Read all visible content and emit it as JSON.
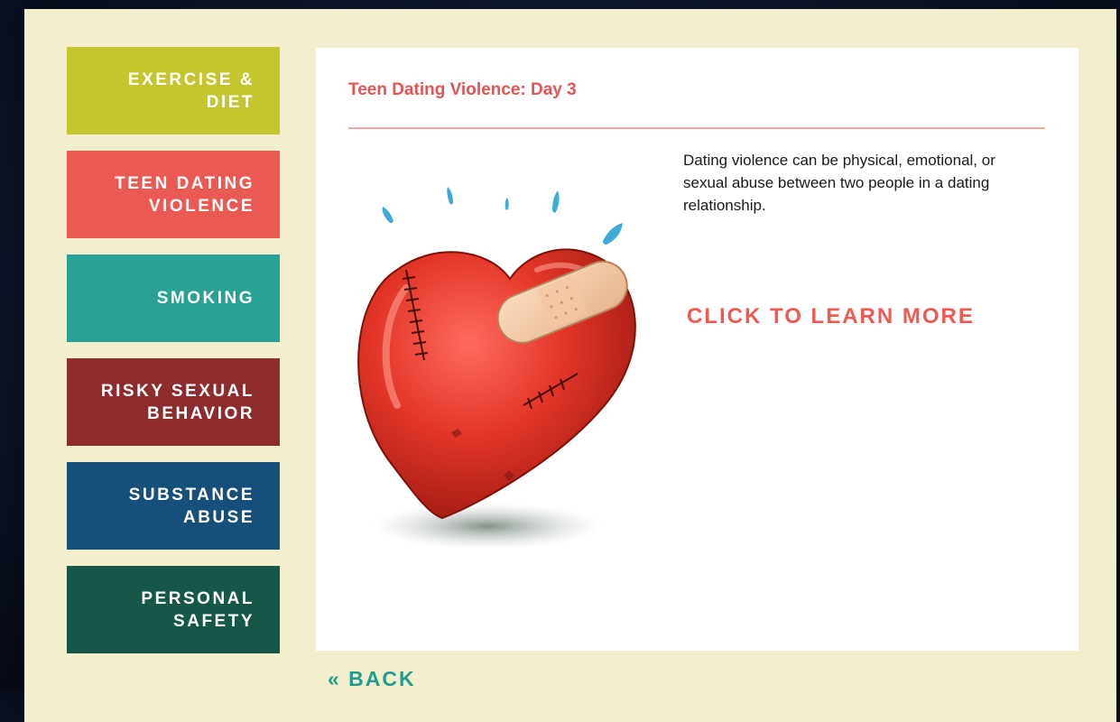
{
  "nav": {
    "items": [
      {
        "label": "EXERCISE &\nDIET",
        "color": "#c5c52f"
      },
      {
        "label": "TEEN DATING\nVIOLENCE",
        "color": "#ea5a53"
      },
      {
        "label": "SMOKING",
        "color": "#27a295"
      },
      {
        "label": "RISKY SEXUAL\nBEHAVIOR",
        "color": "#8e2b2d"
      },
      {
        "label": "SUBSTANCE\nABUSE",
        "color": "#164f7a"
      },
      {
        "label": "PERSONAL\nSAFETY",
        "color": "#17574a"
      }
    ]
  },
  "main": {
    "title": "Teen Dating Violence: Day 3",
    "description": "Dating violence can be physical, emotional, or sexual abuse between two people in a dating relationship.",
    "cta_label": "CLICK TO LEARN MORE",
    "illustration": "bandaged-heart-illustration"
  },
  "back_label": "« BACK"
}
